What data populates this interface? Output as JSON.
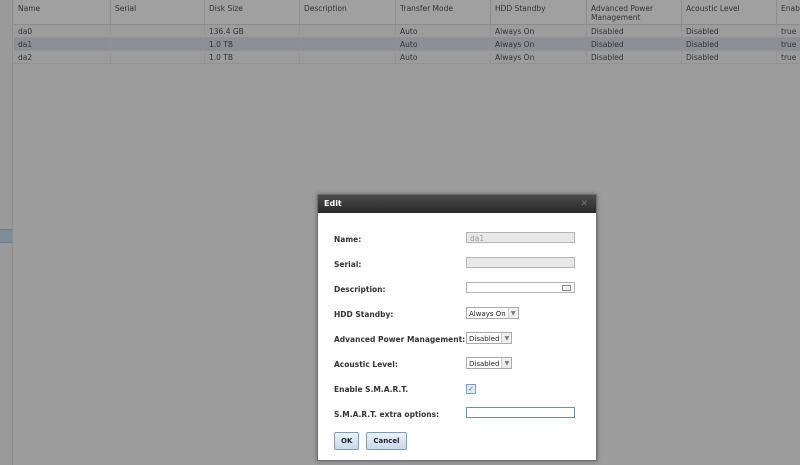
{
  "grid": {
    "columns": [
      "Name",
      "Serial",
      "Disk Size",
      "Description",
      "Transfer Mode",
      "HDD Standby",
      "Advanced Power Management",
      "Acoustic Level",
      "Enab"
    ],
    "rows": [
      {
        "name": "da0",
        "serial": "",
        "size": "136.4 GB",
        "description": "",
        "transfer": "Auto",
        "standby": "Always On",
        "apm": "Disabled",
        "acoustic": "Disabled",
        "smart": "true",
        "selected": false
      },
      {
        "name": "da1",
        "serial": "",
        "size": "1.0 TB",
        "description": "",
        "transfer": "Auto",
        "standby": "Always On",
        "apm": "Disabled",
        "acoustic": "Disabled",
        "smart": "true",
        "selected": true
      },
      {
        "name": "da2",
        "serial": "",
        "size": "1.0 TB",
        "description": "",
        "transfer": "Auto",
        "standby": "Always On",
        "apm": "Disabled",
        "acoustic": "Disabled",
        "smart": "true",
        "selected": false
      }
    ]
  },
  "dialog": {
    "title": "Edit",
    "close_glyph": "✕",
    "fields": {
      "name_label": "Name:",
      "name_value": "da1",
      "serial_label": "Serial:",
      "serial_value": "",
      "description_label": "Description:",
      "description_value": "",
      "standby_label": "HDD Standby:",
      "standby_value": "Always On",
      "apm_label": "Advanced Power Management:",
      "apm_value": "Disabled",
      "acoustic_label": "Acoustic Level:",
      "acoustic_value": "Disabled",
      "smart_label": "Enable S.M.A.R.T.",
      "smart_checked": true,
      "smart_options_label": "S.M.A.R.T. extra options:",
      "smart_options_value": ""
    },
    "ok_label": "OK",
    "cancel_label": "Cancel"
  },
  "icons": {
    "dropdown": "chevron-down-icon",
    "check": "checkmark-icon",
    "edit": "text-edit-icon",
    "close": "close-icon"
  }
}
